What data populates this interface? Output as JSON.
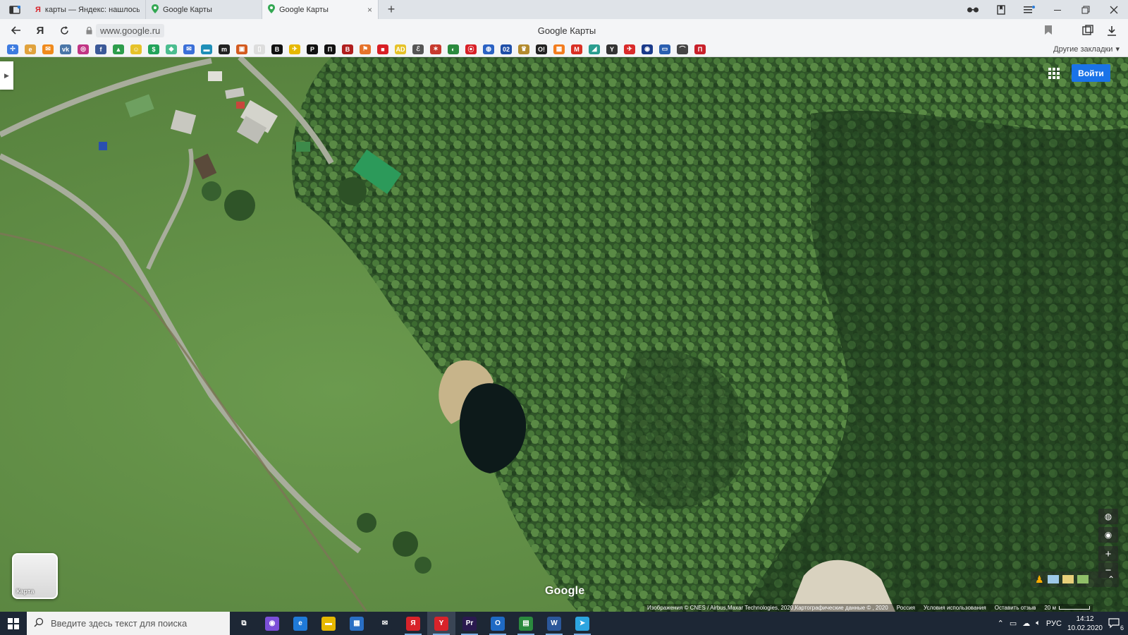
{
  "browser": {
    "tabs": [
      {
        "title": "карты — Яндекс: нашлось",
        "favicon": "yandex-icon",
        "active": false
      },
      {
        "title": "Google Карты",
        "favicon": "google-maps-pin-icon",
        "active": false
      },
      {
        "title": "Google Карты",
        "favicon": "google-maps-pin-icon",
        "active": true,
        "close": "×"
      }
    ],
    "new_tab": "+",
    "url": "www.google.ru",
    "page_title": "Google Карты",
    "yandex_button": "Я",
    "bookmarks_other": "Другие закладки",
    "bookmarks": [
      {
        "icon": "extension-icon",
        "color": "#3d7be0",
        "glyph": "✢"
      },
      {
        "icon": "edge-icon",
        "color": "#e0a23d",
        "glyph": "e"
      },
      {
        "icon": "mail-icon",
        "color": "#f08a1c",
        "glyph": "✉"
      },
      {
        "icon": "vk-icon",
        "color": "#4a76a8",
        "glyph": "vk"
      },
      {
        "icon": "instagram-icon",
        "color": "#c13584",
        "glyph": "◎"
      },
      {
        "icon": "facebook-icon",
        "color": "#3b5998",
        "glyph": "f"
      },
      {
        "icon": "drive-icon",
        "color": "#2d9d4c",
        "glyph": "▲"
      },
      {
        "icon": "smile-icon",
        "color": "#e6c229",
        "glyph": "☺"
      },
      {
        "icon": "money-icon",
        "color": "#22a35a",
        "glyph": "$"
      },
      {
        "icon": "diamond-icon",
        "color": "#4bbd8f",
        "glyph": "◆"
      },
      {
        "icon": "letter-icon",
        "color": "#3a6fd8",
        "glyph": "✉"
      },
      {
        "icon": "card-icon",
        "color": "#1f8fb8",
        "glyph": "▬"
      },
      {
        "icon": "m-icon",
        "color": "#222222",
        "glyph": "m"
      },
      {
        "icon": "photo-icon",
        "color": "#d35a1f",
        "glyph": "▣"
      },
      {
        "icon": "doc-icon",
        "color": "#dddddd",
        "glyph": "▯"
      },
      {
        "icon": "b-icon",
        "color": "#111111",
        "glyph": "B"
      },
      {
        "icon": "plane-icon",
        "color": "#e6b800",
        "glyph": "✈"
      },
      {
        "icon": "p-icon",
        "color": "#111111",
        "glyph": "P"
      },
      {
        "icon": "pi-icon",
        "color": "#111111",
        "glyph": "П"
      },
      {
        "icon": "v-icon",
        "color": "#b01e1e",
        "glyph": "B"
      },
      {
        "icon": "torch-icon",
        "color": "#e6732a",
        "glyph": "⚑"
      },
      {
        "icon": "red-square-icon",
        "color": "#d81f26",
        "glyph": "■"
      },
      {
        "icon": "ad-icon",
        "color": "#e6c229",
        "glyph": "AD"
      },
      {
        "icon": "leaf-icon",
        "color": "#555555",
        "glyph": "ℰ"
      },
      {
        "icon": "star-icon",
        "color": "#c73a2d",
        "glyph": "✶"
      },
      {
        "icon": "flag-icon",
        "color": "#2b8a3e",
        "glyph": "◐"
      },
      {
        "icon": "radio-icon",
        "color": "#d81f26",
        "glyph": "⦿"
      },
      {
        "icon": "globe-icon",
        "color": "#2b62c4",
        "glyph": "◍"
      },
      {
        "icon": "o2-icon",
        "color": "#1f4fa8",
        "glyph": "02"
      },
      {
        "icon": "eagle-icon",
        "color": "#b38b2d",
        "glyph": "♛"
      },
      {
        "icon": "ok-icon",
        "color": "#222222",
        "glyph": "O!"
      },
      {
        "icon": "orange-icon",
        "color": "#f27c1e",
        "glyph": "▦"
      },
      {
        "icon": "gmail-icon",
        "color": "#d93025",
        "glyph": "M"
      },
      {
        "icon": "map-icon",
        "color": "#2a9d8f",
        "glyph": "◢"
      },
      {
        "icon": "y-icon",
        "color": "#333333",
        "glyph": "Y"
      },
      {
        "icon": "bird-icon",
        "color": "#d92a2a",
        "glyph": "✈"
      },
      {
        "icon": "o-icon",
        "color": "#1a3a8a",
        "glyph": "◉"
      },
      {
        "icon": "tv-icon",
        "color": "#2a5fb0",
        "glyph": "▭"
      },
      {
        "icon": "bridge-icon",
        "color": "#444444",
        "glyph": "⌒"
      },
      {
        "icon": "pillar-icon",
        "color": "#c8202a",
        "glyph": "Π"
      }
    ]
  },
  "map": {
    "signin": "Войти",
    "layer_label": "Карта",
    "logo": "Google",
    "zoom_in": "+",
    "zoom_out": "−",
    "attribution": "Изображения © CNES / Airbus,Maxar Technologies, 2020,Картографические данные © , 2020",
    "region": "Россия",
    "terms": "Условия использования",
    "feedback": "Оставить отзыв",
    "scale_label": "20 м"
  },
  "taskbar": {
    "search_placeholder": "Введите здесь текст для поиска",
    "apps": [
      {
        "name": "task-view-icon",
        "glyph": "⧉",
        "color": "#1d2735"
      },
      {
        "name": "cortana-icon",
        "glyph": "◉",
        "color": "#7b4fd8"
      },
      {
        "name": "edge-icon",
        "glyph": "e",
        "color": "#1f7ad8"
      },
      {
        "name": "explorer-icon",
        "glyph": "▬",
        "color": "#e6b800"
      },
      {
        "name": "store-icon",
        "glyph": "▦",
        "color": "#2a6fc4"
      },
      {
        "name": "mail-icon",
        "glyph": "✉",
        "color": "#1d2735"
      },
      {
        "name": "yandex-icon",
        "glyph": "Я",
        "color": "#d8232a"
      },
      {
        "name": "yandex-browser-icon",
        "glyph": "Y",
        "color": "#d8232a"
      },
      {
        "name": "premiere-icon",
        "glyph": "Pr",
        "color": "#2a1a4f"
      },
      {
        "name": "outlook-icon",
        "glyph": "O",
        "color": "#1f6ac4"
      },
      {
        "name": "spreadsheet-icon",
        "glyph": "▤",
        "color": "#2b8a3e"
      },
      {
        "name": "word-icon",
        "glyph": "W",
        "color": "#2b579a"
      },
      {
        "name": "telegram-icon",
        "glyph": "➤",
        "color": "#2ca5e0"
      }
    ],
    "language": "РУС",
    "time": "14:12",
    "date": "10.02.2020",
    "notifications": "6"
  }
}
